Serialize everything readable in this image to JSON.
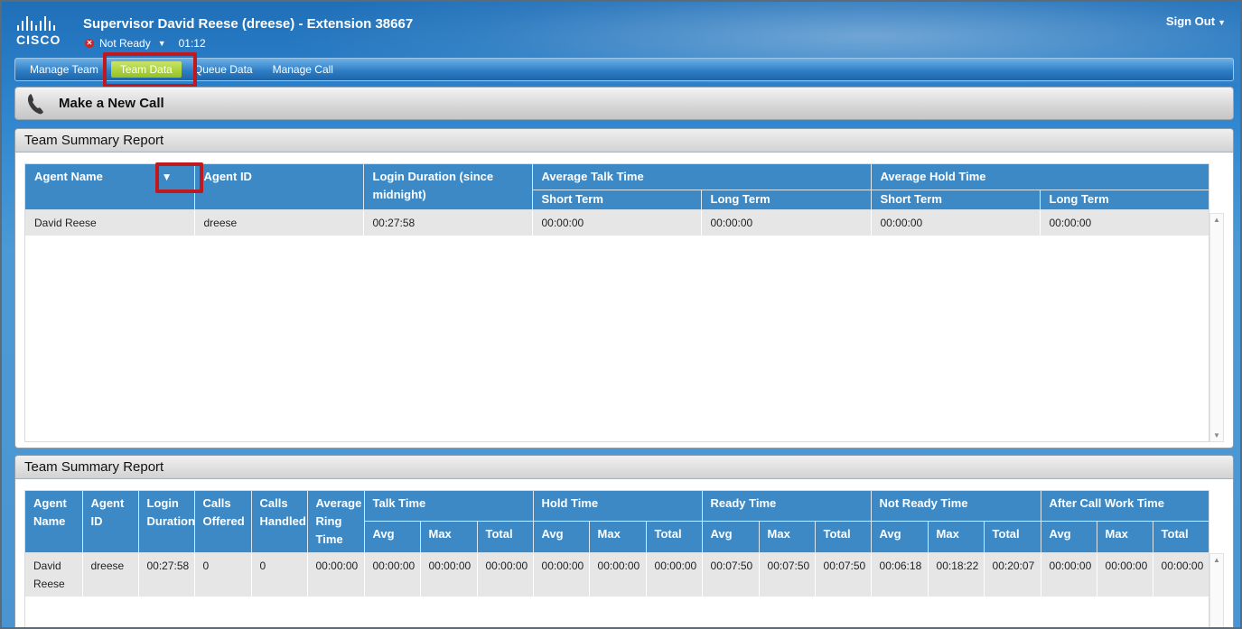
{
  "header": {
    "title": "Supervisor David Reese (dreese) - Extension 38667",
    "logo_text": "CISCO",
    "status": "Not Ready",
    "timer": "01:12",
    "sign_out": "Sign Out"
  },
  "nav": {
    "tabs": [
      {
        "label": "Manage Team"
      },
      {
        "label": "Team Data"
      },
      {
        "label": "Queue Data"
      },
      {
        "label": "Manage Call"
      }
    ],
    "active": "Team Data"
  },
  "new_call": {
    "label": "Make a New Call"
  },
  "report1": {
    "title": "Team Summary Report",
    "headers": {
      "agent_name": "Agent Name",
      "agent_id": "Agent ID",
      "login_duration": "Login Duration (since midnight)",
      "avg_talk": "Average Talk Time",
      "avg_hold": "Average Hold Time",
      "short_term": "Short Term",
      "long_term": "Long Term"
    },
    "rows": [
      {
        "agent_name": "David Reese",
        "agent_id": "dreese",
        "login_duration": "00:27:58",
        "talk_short": "00:00:00",
        "talk_long": "00:00:00",
        "hold_short": "00:00:00",
        "hold_long": "00:00:00"
      }
    ]
  },
  "report2": {
    "title": "Team Summary Report",
    "headers": {
      "agent_name": "Agent Name",
      "agent_id": "Agent ID",
      "login_duration": "Login Duration",
      "calls_offered": "Calls Offered",
      "calls_handled": "Calls Handled",
      "avg_ring": "Average Ring Time",
      "talk_time": "Talk Time",
      "hold_time": "Hold Time",
      "ready_time": "Ready Time",
      "not_ready_time": "Not Ready Time",
      "acw_time": "After Call Work Time",
      "avg": "Avg",
      "max": "Max",
      "total": "Total"
    },
    "rows": [
      {
        "agent_name": "David Reese",
        "agent_id": "dreese",
        "login_duration": "00:27:58",
        "calls_offered": "0",
        "calls_handled": "0",
        "avg_ring": "00:00:00",
        "talk_avg": "00:00:00",
        "talk_max": "00:00:00",
        "talk_total": "00:00:00",
        "hold_avg": "00:00:00",
        "hold_max": "00:00:00",
        "hold_total": "00:00:00",
        "ready_avg": "00:07:50",
        "ready_max": "00:07:50",
        "ready_total": "00:07:50",
        "notready_avg": "00:06:18",
        "notready_max": "00:18:22",
        "notready_total": "00:20:07",
        "acw_avg": "00:00:00",
        "acw_max": "00:00:00",
        "acw_total": "00:00:00"
      }
    ]
  },
  "colors": {
    "header_blue": "#2f86cf",
    "table_header": "#3d89c5",
    "active_tab": "#95c11f",
    "highlight_box": "#c0181f"
  },
  "icons": [
    "cisco-logo",
    "not-ready-icon",
    "phone-icon",
    "sort-arrow-icon"
  ]
}
